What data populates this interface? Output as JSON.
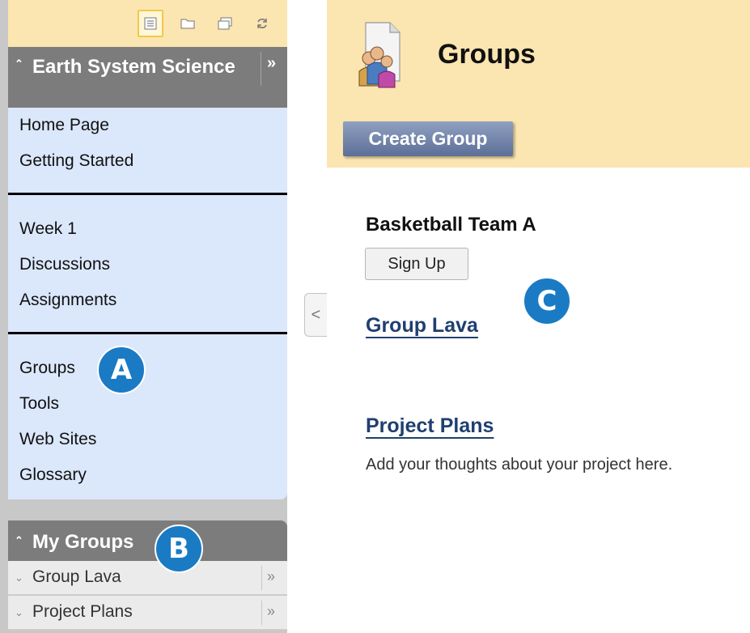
{
  "colors": {
    "header_bg": "#fbe5b0",
    "menu_bg": "#dbe7fb",
    "sidebar_head_bg": "#7c7c7c",
    "link": "#1f3f70",
    "badge": "#1a7bc4",
    "button_primary": "#5d6f97"
  },
  "sidebar": {
    "toolbar": {
      "icons": [
        "list-view-icon",
        "folder-view-icon",
        "window-icon",
        "refresh-icon"
      ],
      "active": "list-view-icon"
    },
    "course": {
      "title": "Earth System Science",
      "collapse_glyph": "»",
      "expand_glyph": "»"
    },
    "menu": {
      "sections": [
        {
          "items": [
            "Home Page",
            "Getting Started"
          ]
        },
        {
          "items": [
            "Week 1",
            "Discussions",
            "Assignments"
          ]
        },
        {
          "items": [
            "Groups",
            "Tools",
            "Web Sites",
            "Glossary"
          ]
        }
      ]
    },
    "my_groups": {
      "title": "My Groups",
      "items": [
        "Group Lava",
        "Project Plans"
      ]
    }
  },
  "main": {
    "title": "Groups",
    "create_button": "Create Group",
    "groups": [
      {
        "name": "Basketball Team A",
        "action": "Sign Up"
      },
      {
        "name": "Group Lava"
      },
      {
        "name": "Project Plans",
        "description": "Add your thoughts about your project here."
      }
    ]
  },
  "callouts": [
    "A",
    "B",
    "C"
  ]
}
